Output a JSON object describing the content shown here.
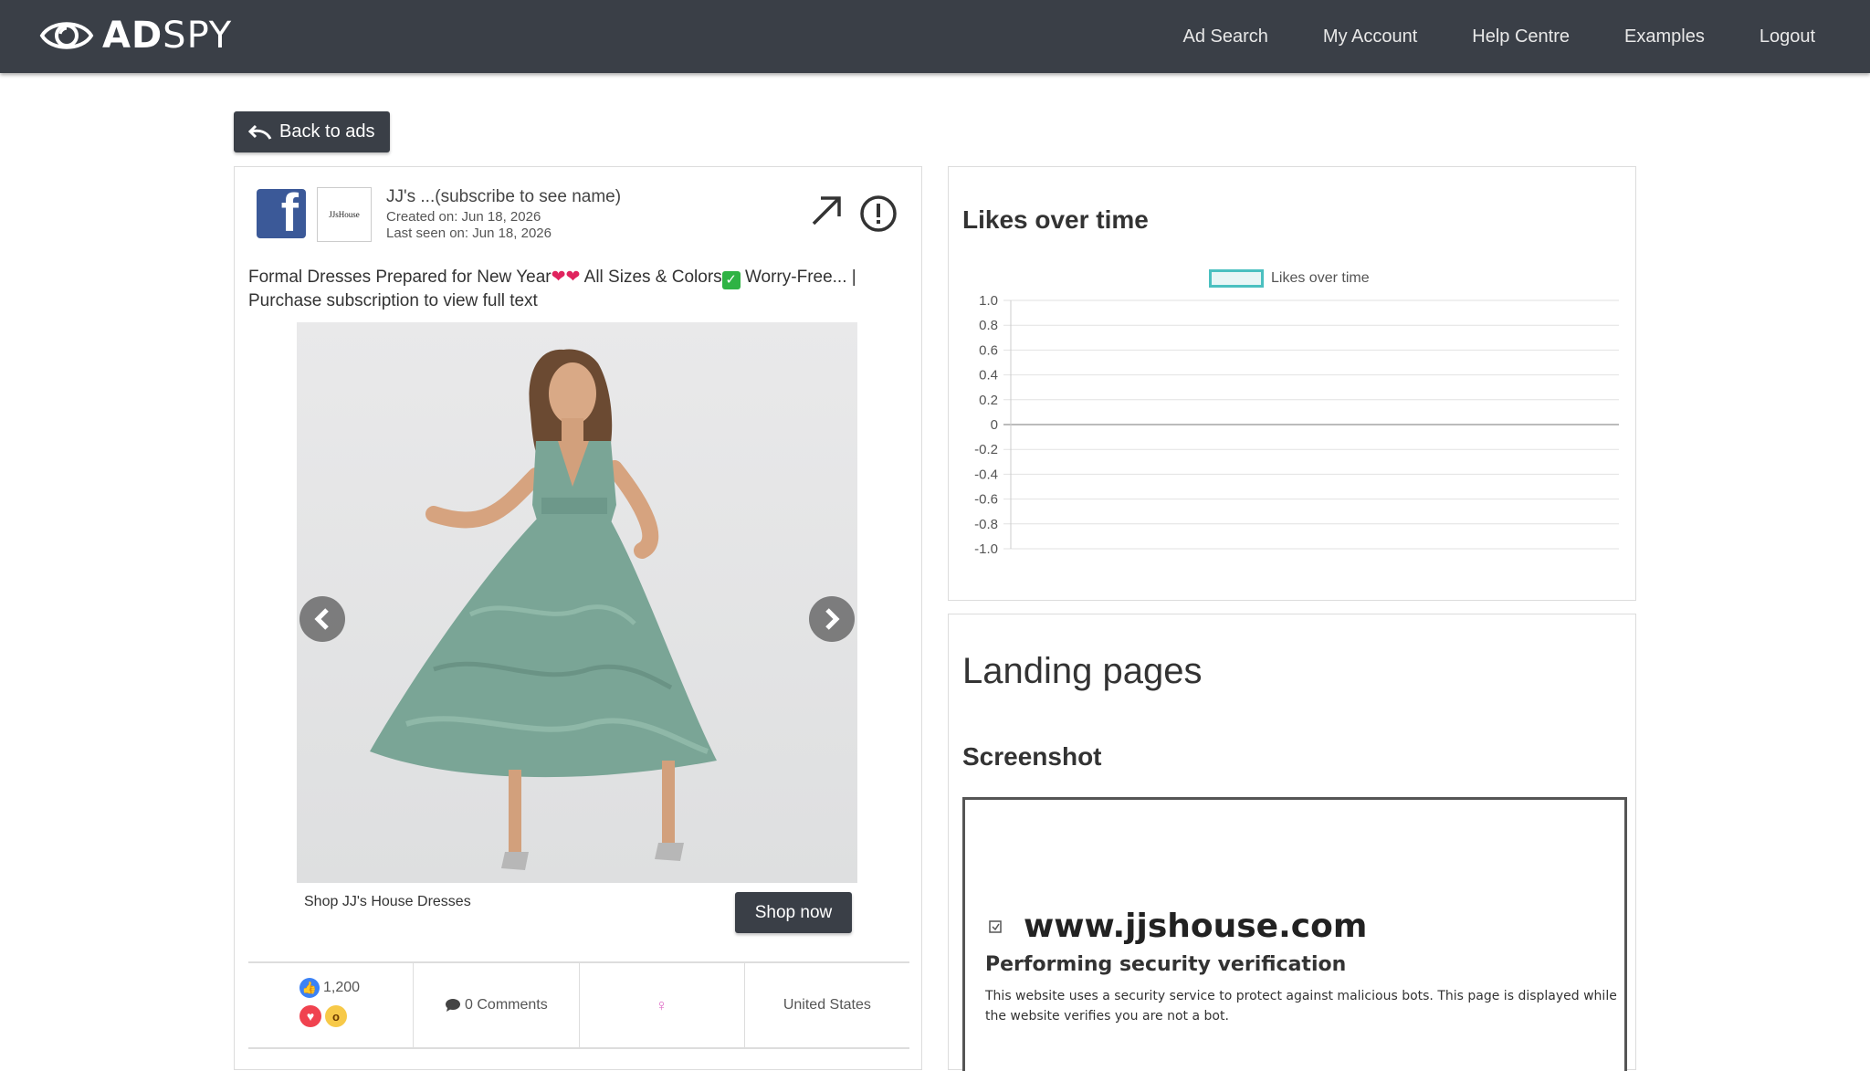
{
  "brand": {
    "bold": "AD",
    "light": "SPY"
  },
  "nav": {
    "items": [
      "Ad Search",
      "My Account",
      "Help Centre",
      "Examples",
      "Logout"
    ]
  },
  "back_button": {
    "label": "Back to ads",
    "icon": "undo-arrow-icon"
  },
  "ad": {
    "page_name": "JJ's ...(subscribe to see name)",
    "page_thumb_text": "JJsHouse",
    "created_on": "Created on: Jun 18, 2026",
    "last_seen_on": "Last seen on: Jun 18, 2026",
    "text_part1": "Formal Dresses Prepared for New Year",
    "text_hearts": "❤❤",
    "text_part2": " All Sizes & Colors",
    "text_check": "✓",
    "text_part3": " Worry-Free... |",
    "text_line2": "Purchase subscription to view full text",
    "cta_caption": "Shop JJ's House Dresses",
    "cta_button": "Shop now",
    "likes": "1,200",
    "comments": "0 Comments",
    "country": "United States"
  },
  "likes_chart": {
    "title": "Likes over time",
    "legend": "Likes over time"
  },
  "chart_data": {
    "type": "line",
    "title": "Likes over time",
    "series": [
      {
        "name": "Likes over time",
        "values": []
      }
    ],
    "yticks": [
      "1.0",
      "0.8",
      "0.6",
      "0.4",
      "0.2",
      "0",
      "-0.2",
      "-0.4",
      "-0.6",
      "-0.8",
      "-1.0"
    ],
    "ylim": [
      -1.0,
      1.0
    ],
    "grid": true,
    "legend_position": "top-center",
    "color": "#4bc0c0"
  },
  "landing": {
    "title": "Landing pages",
    "screenshot_label": "Screenshot",
    "domain": "www.jjshouse.com",
    "heading": "Performing security verification",
    "body": "This website uses a security service to protect against malicious bots. This page is displayed while the website verifies you are not a bot."
  },
  "colors": {
    "nav_bg": "#3a3f47",
    "facebook": "#3b5998",
    "chart_line": "#4bc0c0",
    "dress": "#7aa596"
  }
}
